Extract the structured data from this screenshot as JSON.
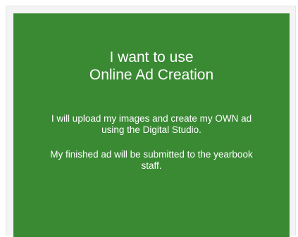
{
  "card": {
    "title_line1": "I want to use",
    "title_line2": "Online Ad Creation",
    "description": "I will upload my images and create my OWN ad using the Digital Studio.",
    "note": "My finished ad will be submitted to the yearbook staff.",
    "background_color": "#3a8a34",
    "text_color": "#ffffff"
  }
}
